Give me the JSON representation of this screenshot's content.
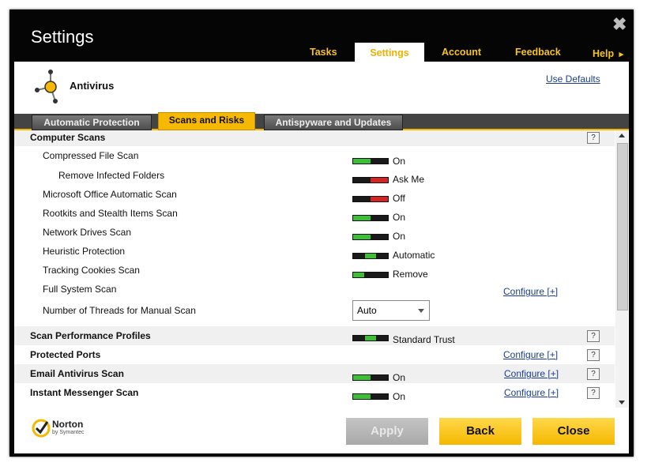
{
  "window": {
    "title": "Settings",
    "close_glyph": "✖"
  },
  "nav": {
    "tasks": "Tasks",
    "settings": "Settings",
    "account": "Account",
    "feedback": "Feedback",
    "help": "Help",
    "help_arrow": "▸"
  },
  "header": {
    "section": "Antivirus",
    "use_defaults": "Use Defaults"
  },
  "subtabs": {
    "automatic_protection": "Automatic Protection",
    "scans_and_risks": "Scans and Risks",
    "antispyware": "Antispyware and Updates"
  },
  "colors": {
    "on": "#39c033",
    "off": "#d42424",
    "accent": "#f6b800"
  },
  "rows": {
    "computer_scans": "Computer Scans",
    "compressed": {
      "label": "Compressed File Scan",
      "value": "On"
    },
    "remove_infected": {
      "label": "Remove Infected Folders",
      "value": "Ask Me"
    },
    "ms_office": {
      "label": "Microsoft Office Automatic Scan",
      "value": "Off"
    },
    "rootkits": {
      "label": "Rootkits and Stealth Items Scan",
      "value": "On"
    },
    "network": {
      "label": "Network Drives Scan",
      "value": "On"
    },
    "heuristic": {
      "label": "Heuristic Protection",
      "value": "Automatic"
    },
    "tracking": {
      "label": "Tracking Cookies Scan",
      "value": "Remove"
    },
    "full_system": {
      "label": "Full System Scan",
      "configure": "Configure [+]"
    },
    "threads": {
      "label": "Number of Threads for Manual Scan",
      "selected": "Auto"
    },
    "perf_profiles": {
      "label": "Scan Performance Profiles",
      "value": "Standard Trust"
    },
    "protected_ports": {
      "label": "Protected Ports",
      "configure": "Configure [+]"
    },
    "email": {
      "label": "Email Antivirus Scan",
      "value": "On",
      "configure": "Configure [+]"
    },
    "im": {
      "label": "Instant Messenger Scan",
      "value": "On",
      "configure": "Configure [+]"
    }
  },
  "help_glyph": "?",
  "footer": {
    "brand": "Norton",
    "brand_sub": "by Symantec",
    "apply": "Apply",
    "back": "Back",
    "close": "Close"
  }
}
